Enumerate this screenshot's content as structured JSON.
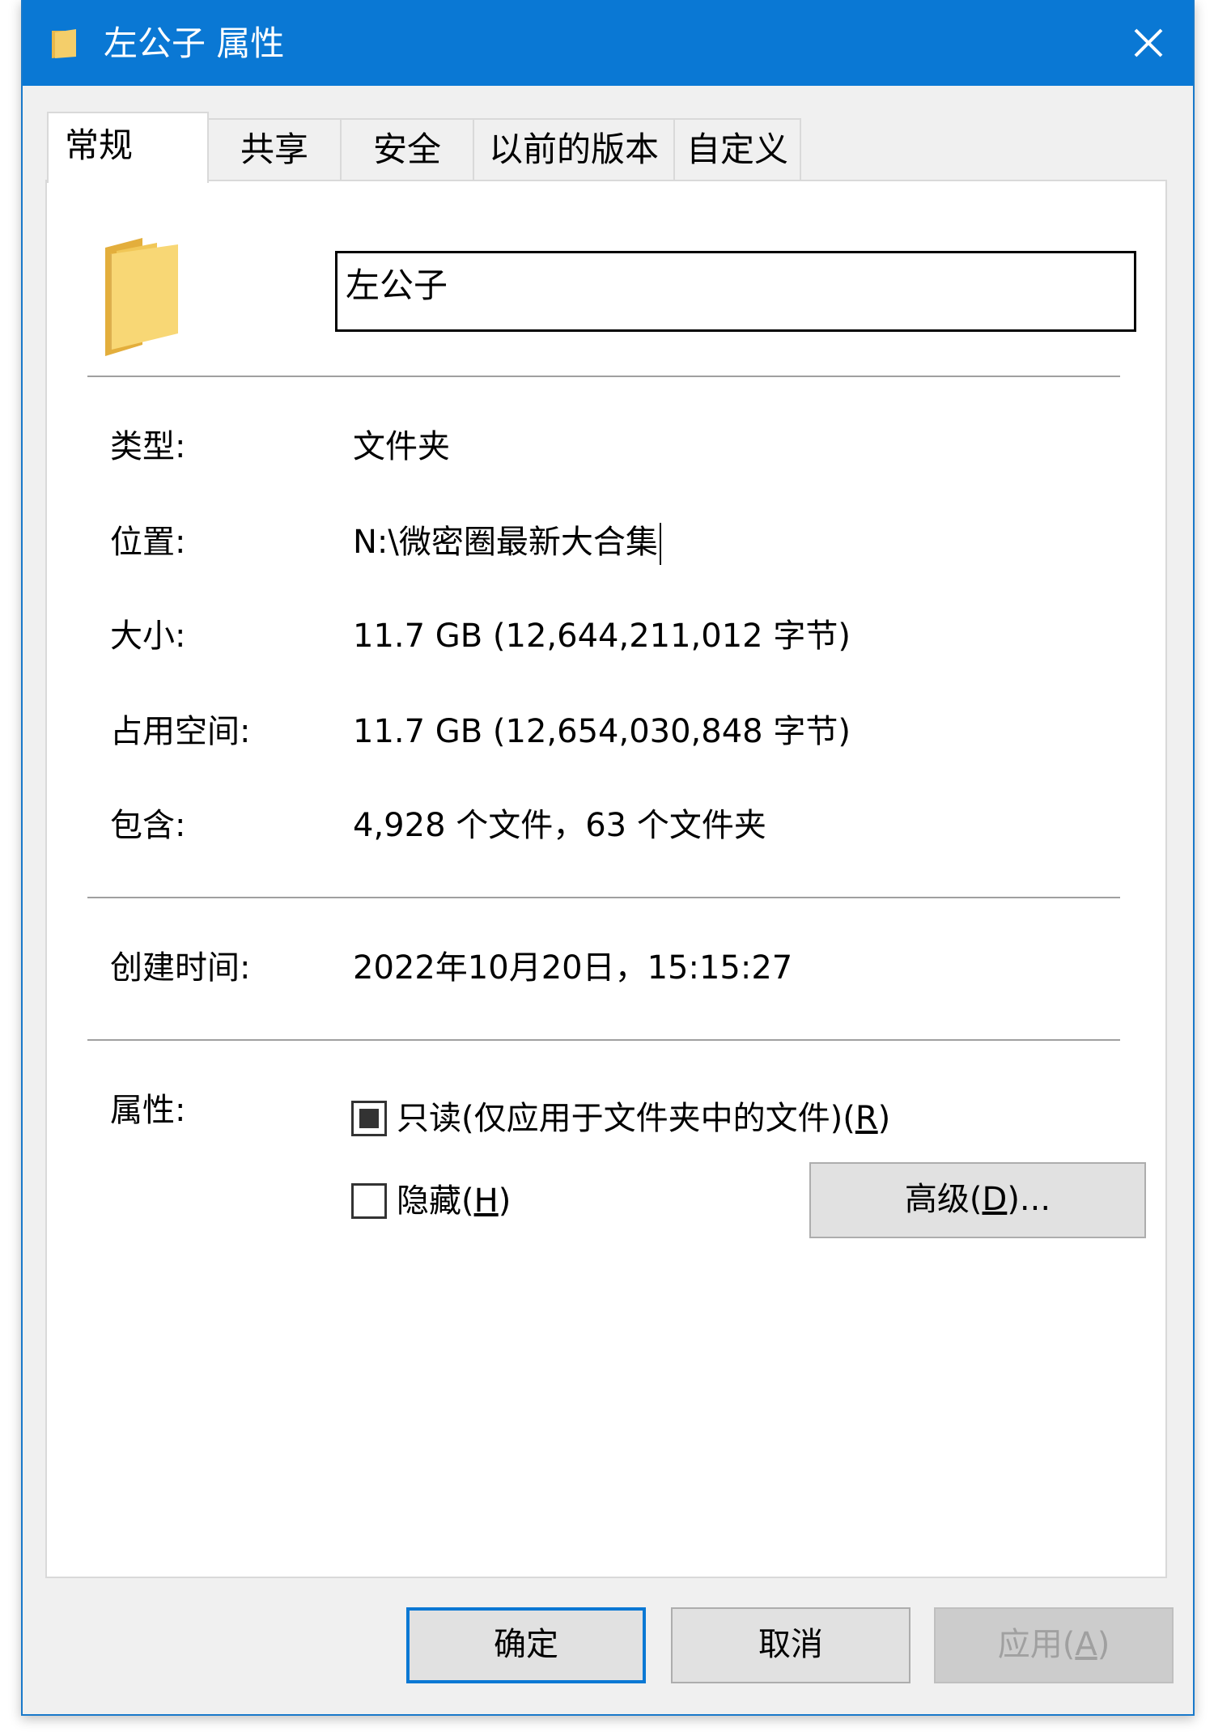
{
  "window": {
    "title": "左公子 属性",
    "close_glyph": "✕",
    "colors": {
      "titlebar": "#0a78d4",
      "folder": "#f4ce6a"
    }
  },
  "tabs": [
    {
      "label": "常规",
      "active": true
    },
    {
      "label": "共享",
      "active": false
    },
    {
      "label": "安全",
      "active": false
    },
    {
      "label": "以前的版本",
      "active": false
    },
    {
      "label": "自定义",
      "active": false
    }
  ],
  "general": {
    "name_value": "左公子",
    "icon": "folder-icon",
    "rows": {
      "type": {
        "label": "类型:",
        "value": "文件夹"
      },
      "location": {
        "label": "位置:",
        "value": "N:\\微密圈最新大合集"
      },
      "size": {
        "label": "大小:",
        "value": "11.7 GB (12,644,211,012 字节)"
      },
      "size_on_disk": {
        "label": "占用空间:",
        "value": "11.7 GB (12,654,030,848 字节)"
      },
      "contains": {
        "label": "包含:",
        "value": "4,928 个文件，63 个文件夹"
      },
      "created": {
        "label": "创建时间:",
        "value": "2022年10月20日，15:15:27"
      }
    },
    "attributes": {
      "label": "属性:",
      "readonly": {
        "label_prefix": "只读(仅应用于文件夹中的文件)(",
        "accel": "R",
        "label_suffix": ")",
        "state": "indeterminate"
      },
      "hidden": {
        "label_prefix": "隐藏(",
        "accel": "H",
        "label_suffix": ")",
        "state": "unchecked"
      },
      "advanced": {
        "label_prefix": "高级(",
        "accel": "D",
        "label_suffix": ")..."
      }
    }
  },
  "buttons": {
    "ok": "确定",
    "cancel": "取消",
    "apply": {
      "label_prefix": "应用(",
      "accel": "A",
      "label_suffix": ")",
      "enabled": false
    }
  }
}
